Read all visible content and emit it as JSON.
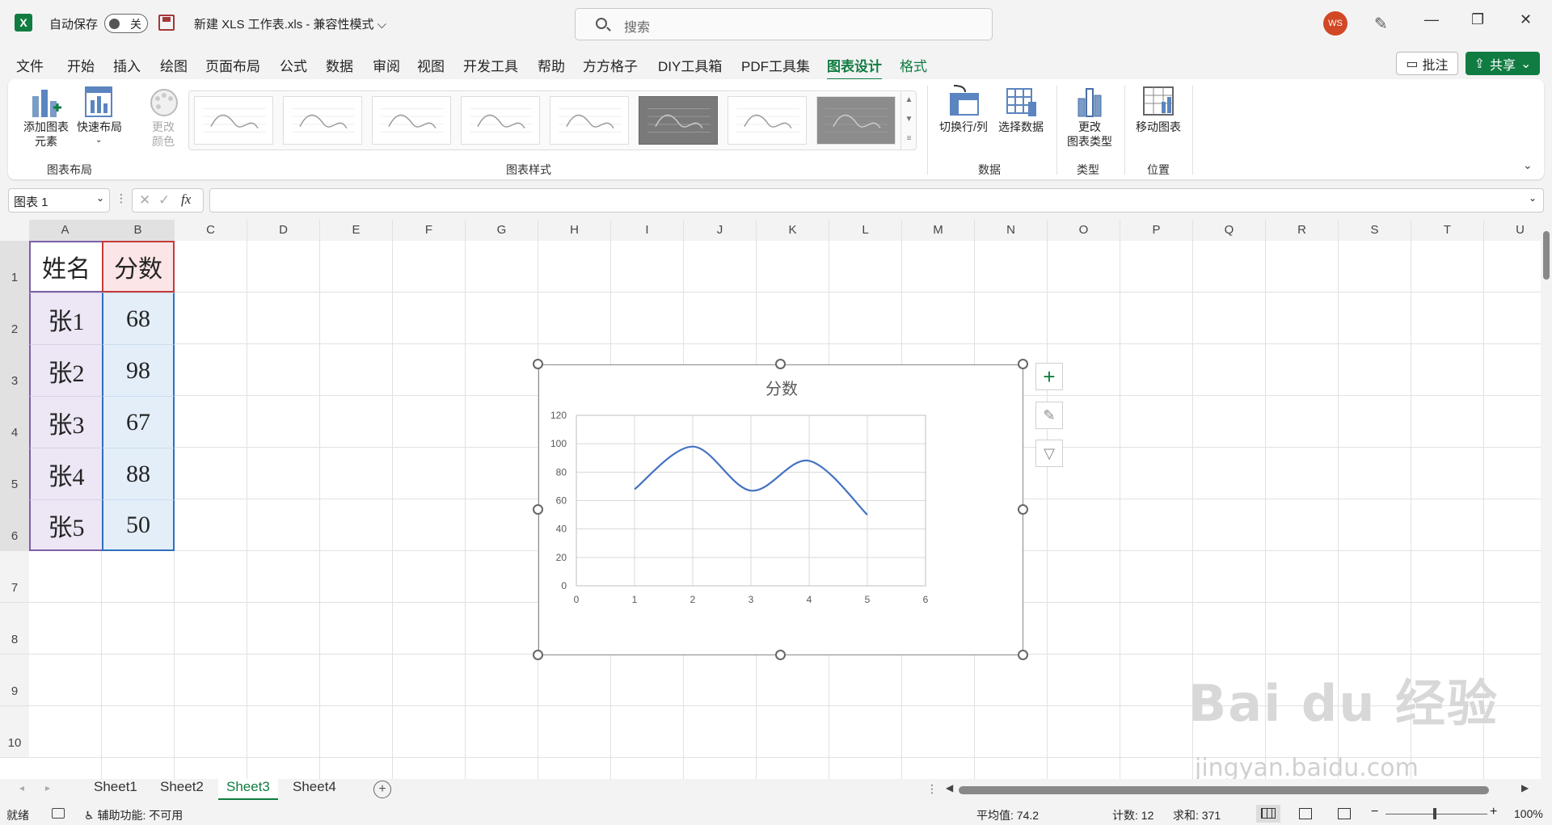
{
  "titlebar": {
    "autosave_label": "自动保存",
    "autosave_state": "关",
    "doc_title": "新建 XLS 工作表.xls  -  兼容性模式 ⌵",
    "search_placeholder": "搜索",
    "avatar_initials": "WS"
  },
  "menu": {
    "items": [
      "文件",
      "开始",
      "插入",
      "绘图",
      "页面布局",
      "公式",
      "数据",
      "审阅",
      "视图",
      "开发工具",
      "帮助",
      "方方格子",
      "DIY工具箱",
      "PDF工具集",
      "图表设计",
      "格式"
    ],
    "active_index": 14,
    "comment_label": "批注",
    "share_label": "共享"
  },
  "ribbon": {
    "add_element": "添加图表\n元素",
    "quick_layout": "快速布局",
    "change_colors": "更改\n颜色",
    "switch_rowcol": "切换行/列",
    "select_data": "选择数据",
    "change_type": "更改\n图表类型",
    "move_chart": "移动图表",
    "groups": {
      "layout": "图表布局",
      "styles": "图表样式",
      "data": "数据",
      "type": "类型",
      "location": "位置"
    }
  },
  "formula_bar": {
    "name_box": "图表 1",
    "fx": "fx",
    "formula": ""
  },
  "grid": {
    "columns": [
      "A",
      "B",
      "C",
      "D",
      "E",
      "F",
      "G",
      "H",
      "I",
      "J",
      "K",
      "L",
      "M",
      "N",
      "O",
      "P",
      "Q",
      "R",
      "S",
      "T",
      "U"
    ],
    "rows": [
      "1",
      "2",
      "3",
      "4",
      "5",
      "6",
      "7",
      "8",
      "9",
      "10"
    ],
    "table": {
      "header": [
        "姓名",
        "分数"
      ],
      "rows": [
        [
          "张1",
          "68"
        ],
        [
          "张2",
          "98"
        ],
        [
          "张3",
          "67"
        ],
        [
          "张4",
          "88"
        ],
        [
          "张5",
          "50"
        ]
      ]
    }
  },
  "chart_data": {
    "type": "scatter",
    "title": "分数",
    "x": [
      1,
      2,
      3,
      4,
      5
    ],
    "values": [
      68,
      98,
      67,
      88,
      50
    ],
    "xlim": [
      0,
      6
    ],
    "ylim": [
      0,
      120
    ],
    "xticks": [
      "0",
      "1",
      "2",
      "3",
      "4",
      "5",
      "6"
    ],
    "yticks": [
      "0",
      "20",
      "40",
      "60",
      "80",
      "100",
      "120"
    ],
    "grid": true,
    "smooth": true,
    "line_color": "#4472c4"
  },
  "sheets": {
    "tabs": [
      "Sheet1",
      "Sheet2",
      "Sheet3",
      "Sheet4"
    ],
    "active_index": 2
  },
  "status": {
    "ready": "就绪",
    "accessibility": "辅助功能: 不可用",
    "average": "平均值: 74.2",
    "count": "计数: 12",
    "sum": "求和: 371",
    "zoom": "100%"
  },
  "watermark": {
    "brand": "Bai du 经验",
    "url": "jingyan.baidu.com"
  },
  "colors": {
    "accent": "#107c41",
    "name_fill": "#ede6f4",
    "score_fill": "#e3eef9",
    "header_score_fill": "#fbe5e6"
  }
}
